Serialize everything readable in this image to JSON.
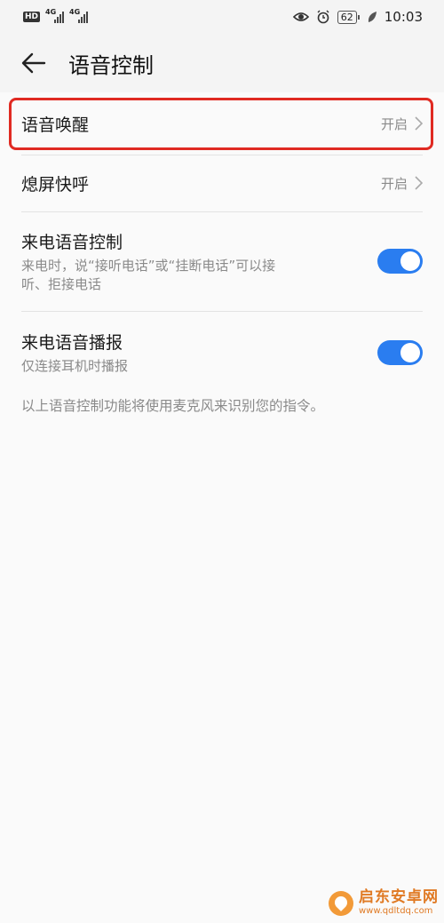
{
  "status_bar": {
    "hd": "HD",
    "net1": "4G",
    "net2": "4G",
    "battery": "62",
    "time": "10:03"
  },
  "app_bar": {
    "title": "语音控制"
  },
  "rows": [
    {
      "title": "语音唤醒",
      "value": "开启"
    },
    {
      "title": "熄屏快呼",
      "value": "开启"
    },
    {
      "title": "来电语音控制",
      "subtitle_line1": "来电时，说“接听电话”或“挂断电话”可以接",
      "subtitle_line2": "听、拒接电话",
      "toggle_on": true
    },
    {
      "title": "来电语音播报",
      "subtitle": "仅连接耳机时播报",
      "toggle_on": true
    }
  ],
  "footnote": "以上语音控制功能将使用麦克风来识别您的指令。",
  "colors": {
    "accent": "#2a7df0",
    "highlight": "#e02a22"
  },
  "watermark": {
    "name": "启东安卓网",
    "url": "www.qdltdq.com"
  }
}
